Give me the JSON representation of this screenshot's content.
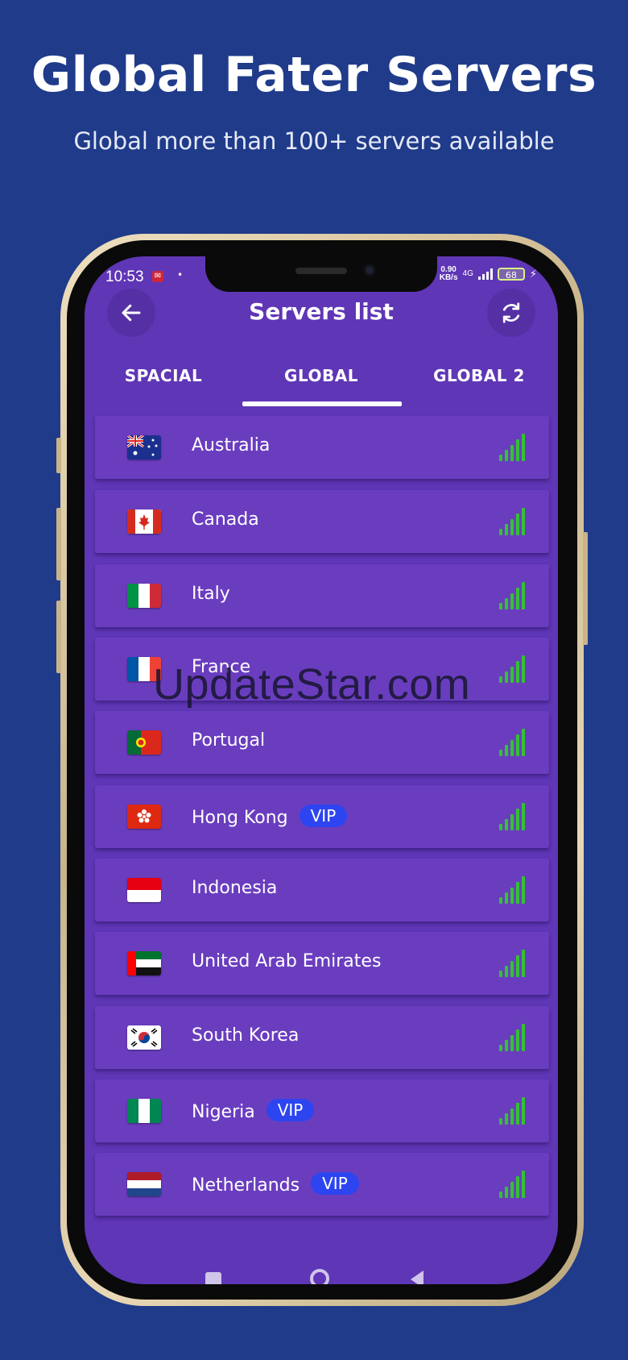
{
  "promo": {
    "headline": "Global Fater Servers",
    "subheadline": "Global more than 100+ servers available"
  },
  "status_bar": {
    "time": "10:53",
    "speed_value": "0.90",
    "speed_unit": "KB/s",
    "network": "4G",
    "battery": "68"
  },
  "appbar": {
    "title": "Servers list",
    "back_icon": "arrow-left-icon",
    "refresh_icon": "refresh-icon"
  },
  "tabs": [
    {
      "label": "SPACIAL",
      "active": false
    },
    {
      "label": "GLOBAL",
      "active": true
    },
    {
      "label": "GLOBAL 2",
      "active": false
    }
  ],
  "servers": [
    {
      "name": "Australia",
      "vip": false,
      "flag": "australia-flag-icon"
    },
    {
      "name": "Canada",
      "vip": false,
      "flag": "canada-flag-icon"
    },
    {
      "name": "Italy",
      "vip": false,
      "flag": "italy-flag-icon"
    },
    {
      "name": "France",
      "vip": false,
      "flag": "france-flag-icon"
    },
    {
      "name": "Portugal",
      "vip": false,
      "flag": "portugal-flag-icon"
    },
    {
      "name": "Hong Kong",
      "vip": true,
      "flag": "hong-kong-flag-icon"
    },
    {
      "name": "Indonesia",
      "vip": false,
      "flag": "indonesia-flag-icon"
    },
    {
      "name": "United Arab Emirates",
      "vip": false,
      "flag": "uae-flag-icon"
    },
    {
      "name": "South Korea",
      "vip": false,
      "flag": "south-korea-flag-icon"
    },
    {
      "name": "Nigeria",
      "vip": true,
      "flag": "nigeria-flag-icon"
    },
    {
      "name": "Netherlands",
      "vip": true,
      "flag": "netherlands-flag-icon"
    }
  ],
  "vip_label": "VIP",
  "signal_icon": "signal-strength-icon",
  "watermark": "UpdateStar.com",
  "colors": {
    "background": "#1f3b8a",
    "screen": "#5f36b5",
    "row": "#6a3dbf",
    "vip_badge": "#2d45f0",
    "signal": "#33c233"
  }
}
